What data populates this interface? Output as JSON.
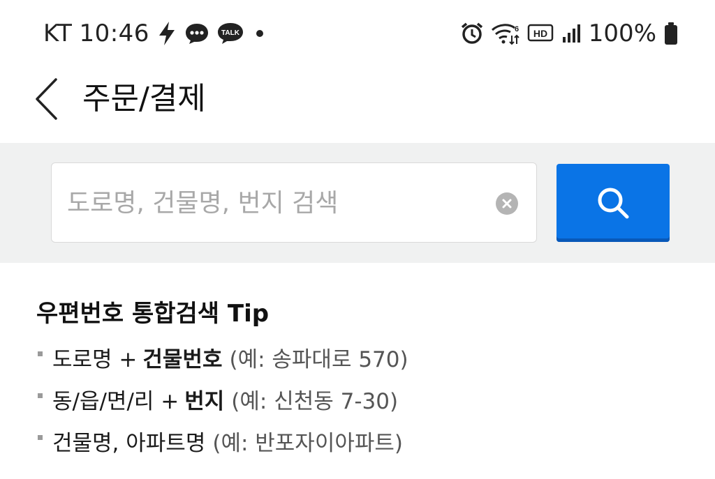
{
  "status_bar": {
    "carrier": "KT",
    "time": "10:46",
    "network_badge": "HD",
    "battery_percent": "100%",
    "talk_badge": "TALK"
  },
  "header": {
    "title": "주문/결제"
  },
  "search": {
    "placeholder": "도로명, 건물명, 번지 검색",
    "value": ""
  },
  "tips": {
    "title": "우편번호 통합검색 Tip",
    "items": [
      {
        "prefix": "도로명 +",
        "strong": "건물번호",
        "example": "(예: 송파대로 570)"
      },
      {
        "prefix": "동/읍/면/리 +",
        "strong": "번지",
        "example": "(예: 신천동 7-30)"
      },
      {
        "prefix": "건물명, 아파트명",
        "strong": "",
        "example": "(예: 반포자이아파트)"
      }
    ]
  },
  "colors": {
    "search_button": "#0a74e6",
    "search_area_bg": "#f0f1f1"
  }
}
